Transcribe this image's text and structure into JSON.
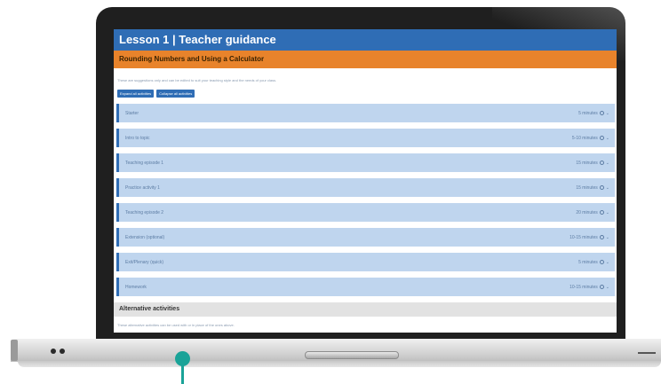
{
  "screen": {
    "title": "Lesson 1 | Teacher guidance",
    "subtitle": "Rounding Numbers and Using a Calculator",
    "intro_text": "These are suggestions only and can be edited to suit your teaching style and the needs of your class.",
    "buttons": [
      "Expand all activities",
      "Collapse all activities"
    ],
    "activities": [
      {
        "name": "Starter",
        "duration": "5 minutes"
      },
      {
        "name": "Intro to topic",
        "duration": "5-10 minutes"
      },
      {
        "name": "Teaching episode 1",
        "duration": "15 minutes"
      },
      {
        "name": "Practice activity 1",
        "duration": "15 minutes"
      },
      {
        "name": "Teaching episode 2",
        "duration": "20 minutes"
      },
      {
        "name": "Extension (optional)",
        "duration": "10-15 minutes"
      },
      {
        "name": "Exit/Plenary (quick)",
        "duration": "5 minutes"
      },
      {
        "name": "Homework",
        "duration": "10-15 minutes"
      }
    ],
    "alternative_heading": "Alternative activities",
    "alternative_text": "These alternative activities can be used with or in place of the ones above."
  },
  "icons": [
    "clock-icon",
    "chevron-down-icon"
  ],
  "colors": {
    "title_bar": "#2f6db5",
    "subtitle_bar": "#e8832b",
    "activity_row": "#bfd5ee",
    "pin": "#1aa398"
  }
}
